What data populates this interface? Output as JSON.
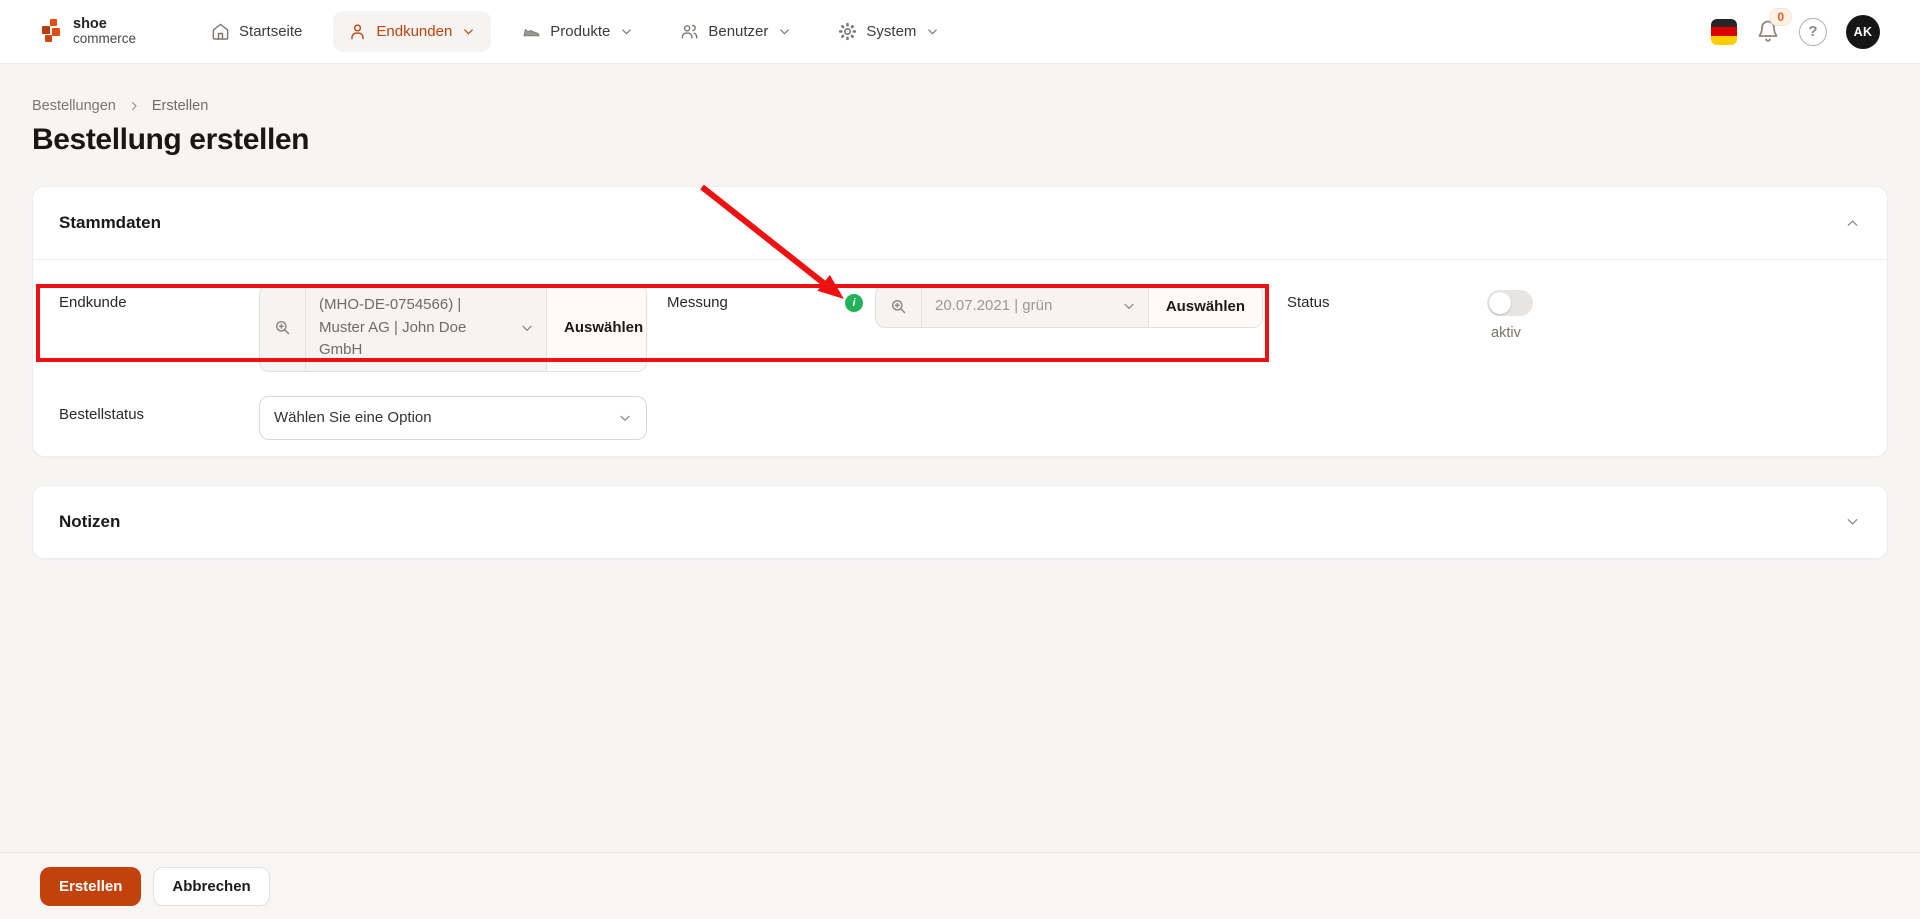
{
  "brand": {
    "line1": "shoe",
    "line2": "commerce"
  },
  "nav": {
    "items": [
      {
        "label": "Startseite"
      },
      {
        "label": "Endkunden"
      },
      {
        "label": "Produkte"
      },
      {
        "label": "Benutzer"
      },
      {
        "label": "System"
      }
    ],
    "notification_count": "0",
    "help_glyph": "?",
    "avatar_initials": "AK"
  },
  "breadcrumb": {
    "item1": "Bestellungen",
    "item2": "Erstellen"
  },
  "page": {
    "title": "Bestellung erstellen"
  },
  "stammdaten": {
    "title": "Stammdaten",
    "endkunde": {
      "label": "Endkunde",
      "value": "(MHO-DE-0754566) | Muster AG | John Doe GmbH",
      "button": "Auswählen"
    },
    "messung": {
      "label": "Messung",
      "info_glyph": "i",
      "value": "20.07.2021 | grün",
      "button": "Auswählen"
    },
    "status": {
      "label": "Status",
      "toggle_state": "off",
      "state_label": "aktiv"
    },
    "bestellstatus": {
      "label": "Bestellstatus",
      "placeholder": "Wählen Sie eine Option"
    }
  },
  "notizen": {
    "title": "Notizen"
  },
  "footer": {
    "submit": "Erstellen",
    "cancel": "Abbrechen"
  },
  "colors": {
    "accent_orange": "#c2410c",
    "annotation_red": "#ed1111",
    "info_green": "#22b35a",
    "avatar_bg": "#161616",
    "flag_colors": [
      "#262626",
      "#dd0000",
      "#ffce00"
    ]
  }
}
